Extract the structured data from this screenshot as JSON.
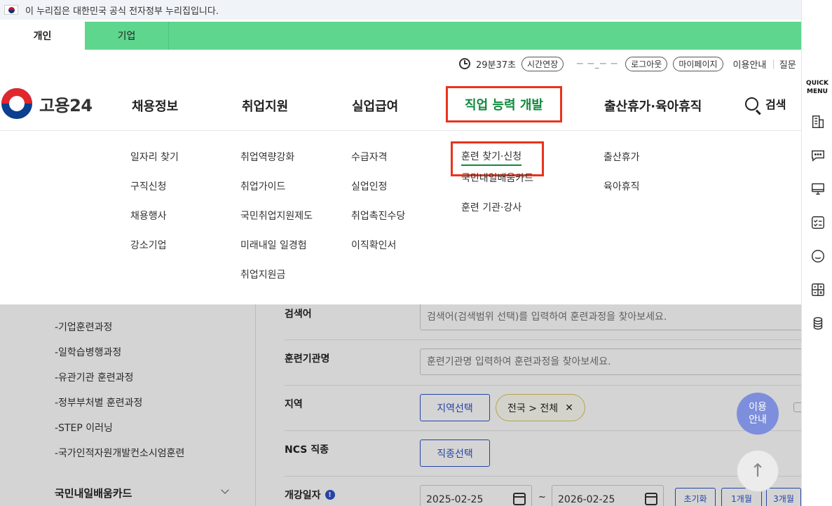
{
  "banner": {
    "text": "이 누리집은 대한민국 공식 전자정부 누리집입니다."
  },
  "audience_tabs": [
    {
      "label": "개인",
      "active": true
    },
    {
      "label": "기업",
      "active": false
    }
  ],
  "utility": {
    "session_timer": "29분37초",
    "extend_label": "시간연장",
    "user_name_masked": "ㅡ ㅡ_ㅡ ㅡ",
    "logout_label": "로그아웃",
    "mypage_label": "마이페이지",
    "guide_label": "이용안내",
    "faq_label": "질문"
  },
  "logo": {
    "text": "고용24"
  },
  "gnb": [
    {
      "label": "채용정보"
    },
    {
      "label": "취업지원"
    },
    {
      "label": "실업급여"
    },
    {
      "label": "직업 능력 개발",
      "highlighted": true
    },
    {
      "label": "출산휴가·육아휴직"
    }
  ],
  "search_label": "검색",
  "mega_menu": {
    "jobs": [
      "일자리 찾기",
      "구직신청",
      "채용행사",
      "강소기업"
    ],
    "employment_support": [
      "취업역량강화",
      "취업가이드",
      "국민취업지원제도",
      "미래내일 일경험",
      "취업지원금"
    ],
    "unemployment_benefit": [
      "수급자격",
      "실업인정",
      "취업촉진수당",
      "이직확인서"
    ],
    "vocational_training": [
      "훈련 찾기·신청",
      "국민내일배움카드",
      "훈련 기관·강사"
    ],
    "leave": [
      "출산휴가",
      "육아휴직"
    ]
  },
  "lnb": {
    "items": [
      "-기업훈련과정",
      "-일학습병행과정",
      "-유관기관 훈련과정",
      "-정부부처별 훈련과정",
      "-STEP 이러닝",
      "-국가인적자원개발컨소시엄훈련"
    ],
    "section_title": "국민내일배움카드"
  },
  "search_form": {
    "keyword_label": "검색어",
    "keyword_placeholder": "검색어(검색범위 선택)를 입력하여 훈련과정을 찾아보세요.",
    "institution_label": "훈련기관명",
    "institution_placeholder": "훈련기관명 입력하여 훈련과정을 찾아보세요.",
    "region_label": "지역",
    "region_button": "지역선택",
    "region_chip": "전국 > 전체",
    "ncs_label": "NCS 직종",
    "ncs_button": "직종선택",
    "start_date_label": "개강일자",
    "start_date_from": "2025-02-25",
    "date_separator": "~",
    "start_date_to": "2026-02-25",
    "reset_label": "초기화",
    "one_month_label": "1개월",
    "three_month_label": "3개월"
  },
  "float": {
    "guide_line1": "이용",
    "guide_line2": "안내",
    "top_arrow": "↑"
  },
  "quick_menu": {
    "title_line1": "QUICK",
    "title_line2": "MENU",
    "icons": [
      "building-icon",
      "chat-icon",
      "monitor-icon",
      "checklist-icon",
      "smile-icon",
      "calculator-icon",
      "coins-icon"
    ]
  },
  "colors": {
    "tab_bar": "#5fd68e",
    "highlight_border": "#e8341c",
    "active_menu_text": "#0f8a3c",
    "primary_blue": "#2d52c8",
    "float_button": "#7d8fdc"
  }
}
